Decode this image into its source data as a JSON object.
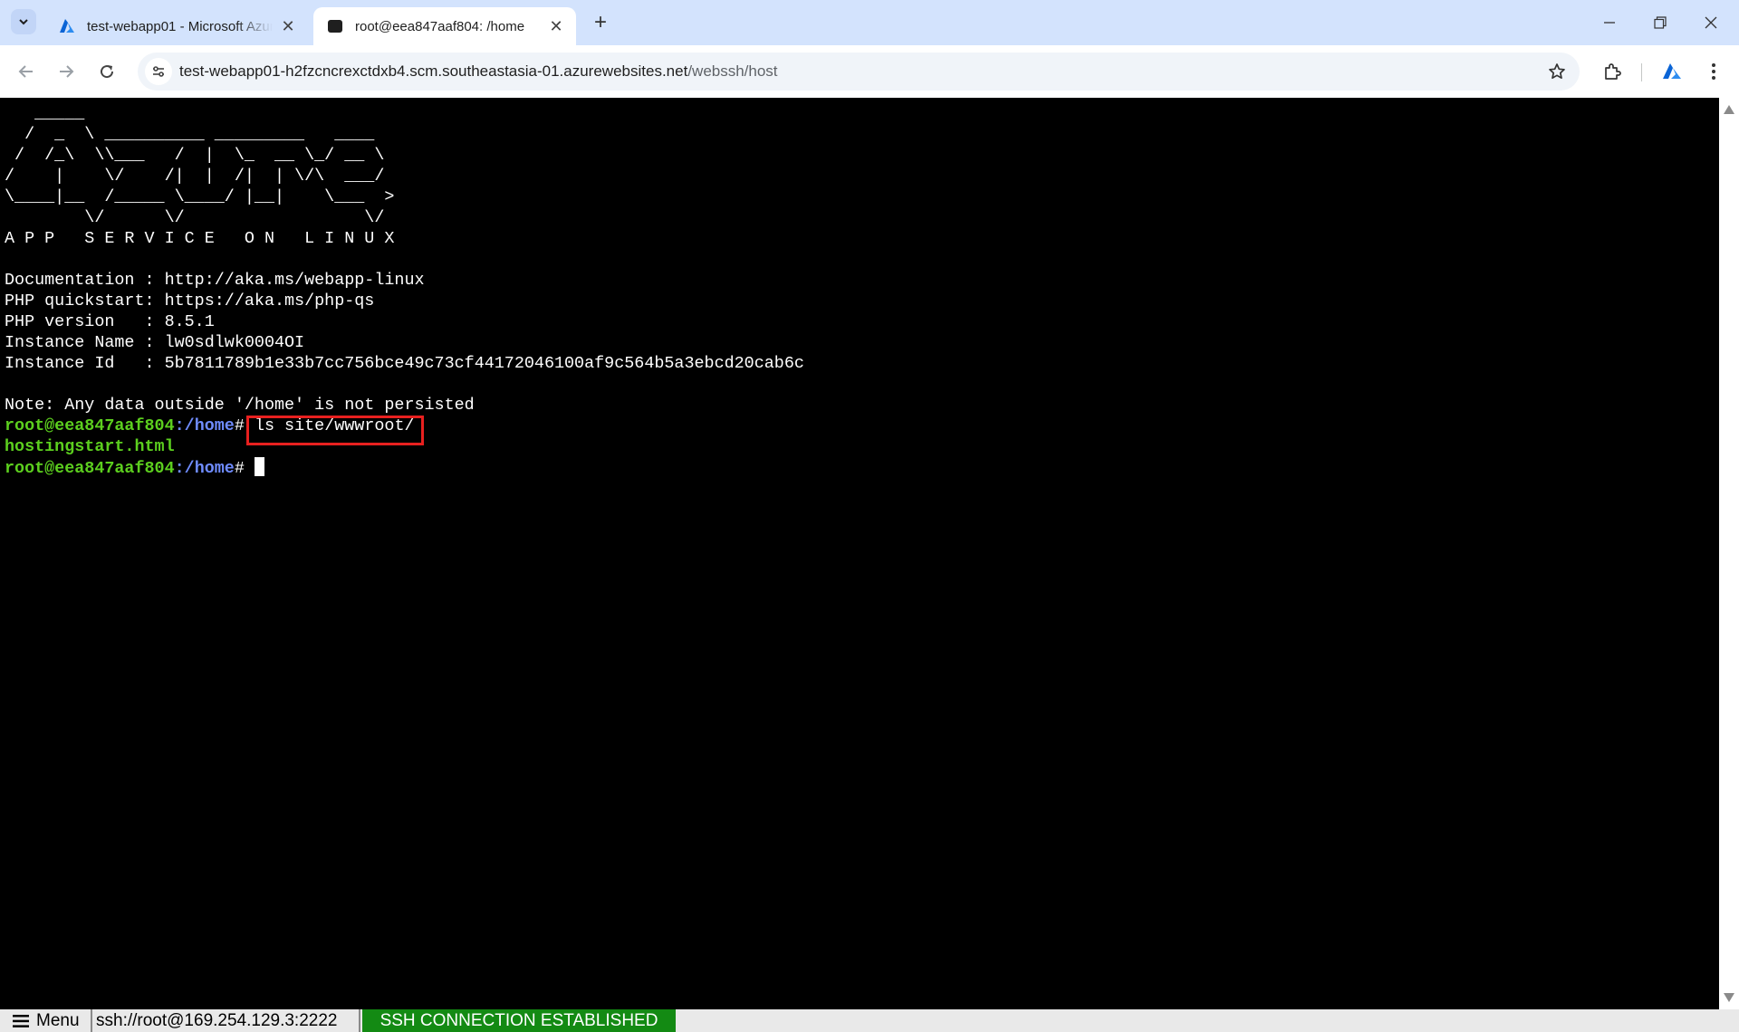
{
  "browser": {
    "tabs": [
      {
        "title": "test-webapp01 - Microsoft Azure",
        "favicon": "azure-icon",
        "active": false
      },
      {
        "title": "root@eea847aaf804: /home",
        "favicon": "terminal-icon",
        "active": true
      }
    ],
    "url_host": "test-webapp01-h2fzcncrexctdxb4.scm.southeastasia-01.azurewebsites.net",
    "url_path": "/webssh/host",
    "accent_color": "#d3e3fd"
  },
  "terminal": {
    "banner": [
      "   _____",
      "  /  _  \\ __________ _________   ____",
      " /  /_\\  \\\\___   /  |  \\_  __ \\_/ __ \\",
      "/    |    \\/    /|  |  /|  | \\/\\  ___/",
      "\\____|__  /_____ \\____/ |__|    \\___  >",
      "        \\/      \\/                  \\/"
    ],
    "banner_title": "A P P   S E R V I C E   O N   L I N U X",
    "info": [
      "Documentation : http://aka.ms/webapp-linux",
      "PHP quickstart: https://aka.ms/php-qs",
      "PHP version   : 8.5.1",
      "Instance Name : lw0sdlwk0004OI",
      "Instance Id   : 5b7811789b1e33b7cc756bce49c73cf44172046100af9c564b5a3ebcd20cab6c"
    ],
    "note": "Note: Any data outside '/home' is not persisted",
    "prompt_user": "root@eea847aaf804",
    "prompt_path": ":/home",
    "prompt_symbol": "#",
    "command": "ls site/wwwroot/",
    "output": "hostingstart.html"
  },
  "statusbar": {
    "menu_label": "Menu",
    "connection": "ssh://root@169.254.129.3:2222",
    "status": "SSH CONNECTION ESTABLISHED",
    "status_color": "#138a13"
  }
}
